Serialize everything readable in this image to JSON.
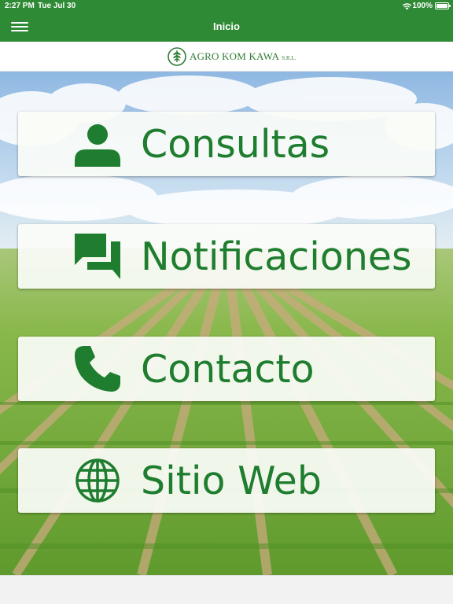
{
  "status_bar": {
    "time": "2:27 PM",
    "date": "Tue Jul 30",
    "battery": "100%"
  },
  "nav": {
    "title": "Inicio"
  },
  "logo": {
    "name": "AGRO KOM KAWA",
    "suffix": "S.R.L."
  },
  "menu": {
    "consultas": "Consultas",
    "notificaciones": "Notificaciones",
    "contacto": "Contacto",
    "sitio_web": "Sitio Web"
  },
  "icons": {
    "consultas": "person-icon",
    "notificaciones": "chat-icon",
    "contacto": "phone-icon",
    "sitio_web": "globe-icon"
  },
  "colors": {
    "brand_green": "#2f8a35",
    "text_green": "#1e7d2e"
  }
}
